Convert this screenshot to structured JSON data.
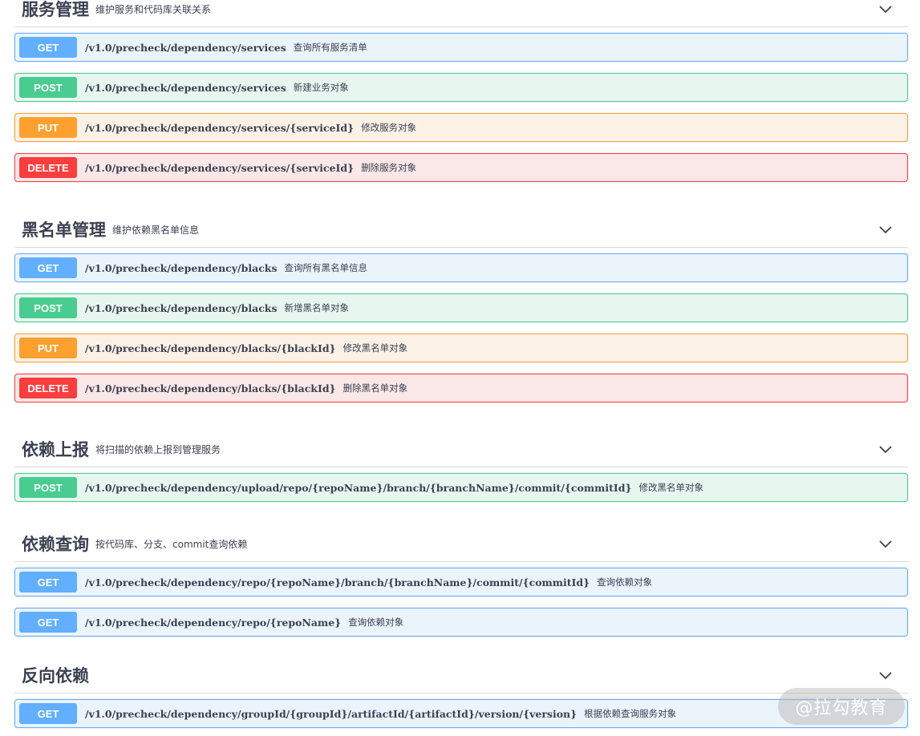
{
  "sections": [
    {
      "title": "服务管理",
      "description": "维护服务和代码库关联关系",
      "operations": [
        {
          "method": "GET",
          "path": "/v1.0/precheck/dependency/services",
          "summary": "查询所有服务清单"
        },
        {
          "method": "POST",
          "path": "/v1.0/precheck/dependency/services",
          "summary": "新建业务对象"
        },
        {
          "method": "PUT",
          "path": "/v1.0/precheck/dependency/services/{serviceId}",
          "summary": "修改服务对象"
        },
        {
          "method": "DELETE",
          "path": "/v1.0/precheck/dependency/services/{serviceId}",
          "summary": "删除服务对象"
        }
      ]
    },
    {
      "title": "黑名单管理",
      "description": "维护依赖黑名单信息",
      "operations": [
        {
          "method": "GET",
          "path": "/v1.0/precheck/dependency/blacks",
          "summary": "查询所有黑名单信息"
        },
        {
          "method": "POST",
          "path": "/v1.0/precheck/dependency/blacks",
          "summary": "新增黑名单对象"
        },
        {
          "method": "PUT",
          "path": "/v1.0/precheck/dependency/blacks/{blackId}",
          "summary": "修改黑名单对象"
        },
        {
          "method": "DELETE",
          "path": "/v1.0/precheck/dependency/blacks/{blackId}",
          "summary": "删除黑名单对象"
        }
      ]
    },
    {
      "title": "依赖上报",
      "description": "将扫描的依赖上报到管理服务",
      "operations": [
        {
          "method": "POST",
          "path": "/v1.0/precheck/dependency/upload/repo/{repoName}/branch/{branchName}/commit/{commitId}",
          "summary": "修改黑名单对象"
        }
      ]
    },
    {
      "title": "依赖查询",
      "description": "按代码库、分支、commit查询依赖",
      "operations": [
        {
          "method": "GET",
          "path": "/v1.0/precheck/dependency/repo/{repoName}/branch/{branchName}/commit/{commitId}",
          "summary": "查询依赖对象"
        },
        {
          "method": "GET",
          "path": "/v1.0/precheck/dependency/repo/{repoName}",
          "summary": "查询依赖对象"
        }
      ]
    },
    {
      "title": "反向依赖",
      "description": "",
      "operations": [
        {
          "method": "GET",
          "path": "/v1.0/precheck/dependency/groupId/{groupId}/artifactId/{artifactId}/version/{version}",
          "summary": "根据依赖查询服务对象"
        }
      ]
    }
  ],
  "watermark": "@拉勾教育",
  "icons": {
    "toggle": "chevron-down-icon"
  },
  "colors": {
    "get": "#61affe",
    "post": "#49cc90",
    "put": "#fca130",
    "delete": "#f93e3e",
    "text": "#3b4151"
  }
}
